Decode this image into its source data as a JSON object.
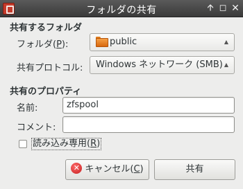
{
  "window": {
    "title": "フォルダの共有",
    "controls": [
      "up-arrow",
      "maximize",
      "close"
    ]
  },
  "share_section": {
    "title": "共有するフォルダ",
    "folder_label_prefix": "フォルダ(",
    "folder_label_mnemonic": "P",
    "folder_label_suffix": "):",
    "folder_value": "public",
    "protocol_label": "共有プロトコル:",
    "protocol_value": "Windows ネットワーク (SMB)"
  },
  "properties_section": {
    "title": "共有のプロパティ",
    "name_label": "名前:",
    "name_value": "zfspool",
    "comment_label": "コメント:",
    "comment_value": "",
    "readonly_label_prefix": "読み込み専用(",
    "readonly_label_mnemonic": "R",
    "readonly_label_suffix": ")",
    "readonly_checked": false
  },
  "buttons": {
    "cancel_prefix": "キャンセル(",
    "cancel_mnemonic": "C",
    "cancel_suffix": ")",
    "share": "共有"
  }
}
